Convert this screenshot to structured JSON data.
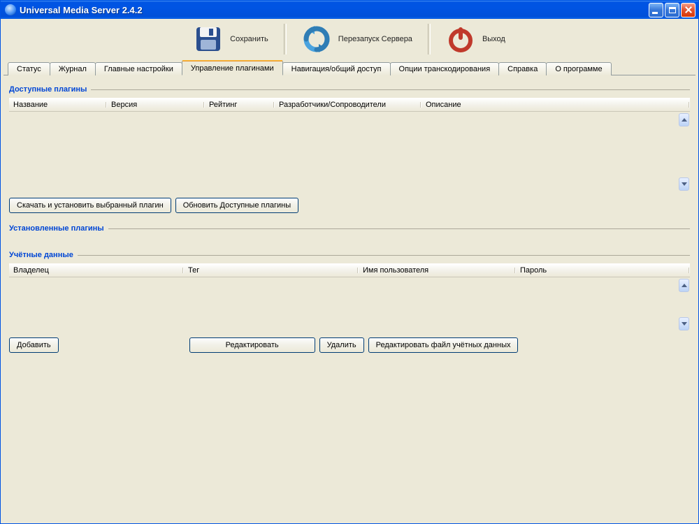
{
  "window": {
    "title": "Universal Media Server 2.4.2"
  },
  "toolbar": {
    "save": "Сохранить",
    "restart": "Перезапуск Сервера",
    "quit": "Выход"
  },
  "tabs": {
    "status": "Статус",
    "log": "Журнал",
    "general": "Главные настройки",
    "plugins": "Управление плагинами",
    "navshare": "Навигация/общий доступ",
    "transcode": "Опции транскодирования",
    "help": "Справка",
    "about": "О программе"
  },
  "sections": {
    "available": "Доступные плагины",
    "installed": "Установленные плагины",
    "credentials": "Учётные данные"
  },
  "available_columns": {
    "name": "Название",
    "version": "Версия",
    "rating": "Рейтинг",
    "authors": "Разработчики/Сопроводители",
    "description": "Описание"
  },
  "cred_columns": {
    "owner": "Владелец",
    "tag": "Тег",
    "username": "Имя пользователя",
    "password": "Пароль"
  },
  "buttons": {
    "download_install": "Скачать и установить выбранный плагин",
    "refresh_available": "Обновить Доступные плагины",
    "add": "Добавить",
    "edit": "Редактировать",
    "delete": "Удалить",
    "edit_cred_file": "Редактировать файл учётных данных"
  }
}
